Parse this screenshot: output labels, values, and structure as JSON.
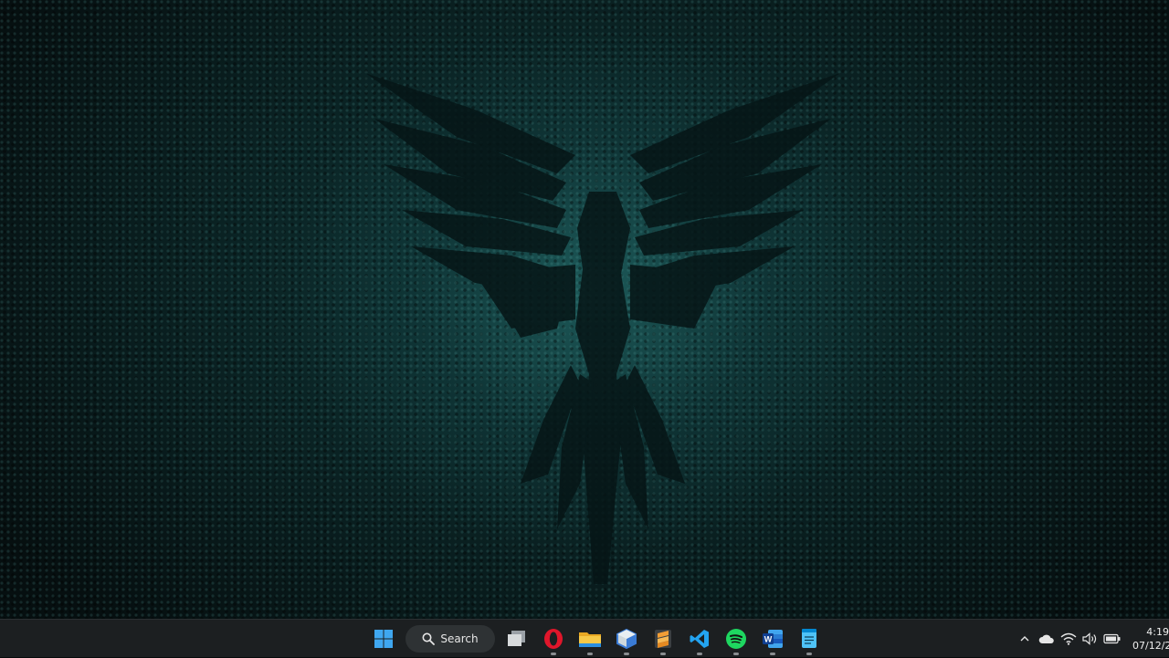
{
  "wallpaper": {
    "name": "Parrot OS mosaic parrot wallpaper",
    "accent_color": "#1e6b69"
  },
  "taskbar": {
    "start_icon": "windows-start-icon",
    "search": {
      "label": "Search",
      "icon": "search-icon"
    },
    "apps": [
      {
        "name": "task-view",
        "icon": "task-view-icon"
      },
      {
        "name": "opera",
        "icon": "opera-icon",
        "color": "#e0162b"
      },
      {
        "name": "file-explorer",
        "icon": "folder-icon",
        "color": "#f5c542"
      },
      {
        "name": "virtualbox",
        "icon": "virtualbox-icon",
        "color": "#3a7bd5"
      },
      {
        "name": "sublime-text",
        "icon": "sublime-icon",
        "color": "#f29d35"
      },
      {
        "name": "vscode",
        "icon": "vscode-icon",
        "color": "#23a3f0"
      },
      {
        "name": "spotify",
        "icon": "spotify-icon",
        "color": "#1ed760"
      },
      {
        "name": "word",
        "icon": "word-icon",
        "color": "#2b6bd6"
      },
      {
        "name": "notepad",
        "icon": "notepad-icon",
        "color": "#4fc3f7"
      }
    ],
    "tray": {
      "icons": [
        "chevron-up-icon",
        "onedrive-icon",
        "wifi-icon",
        "volume-icon",
        "battery-icon"
      ],
      "time": "4:19",
      "date": "07/12/2"
    }
  }
}
